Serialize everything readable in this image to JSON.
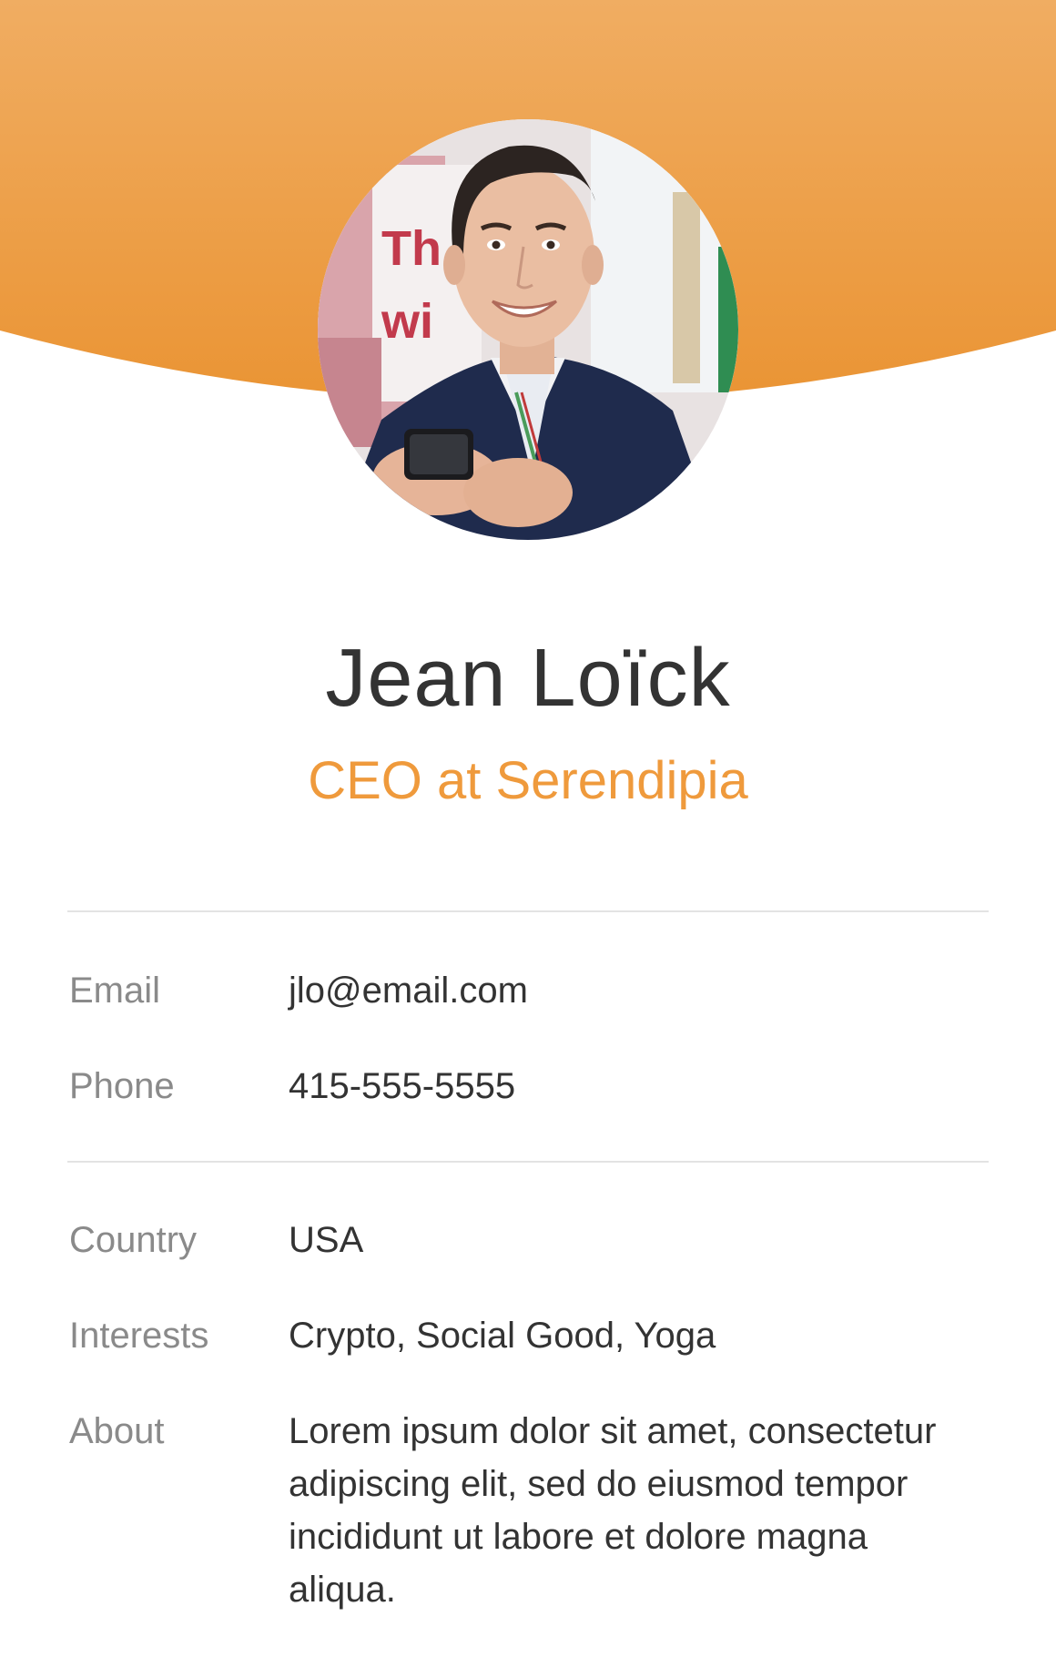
{
  "profile": {
    "name": "Jean Loïck",
    "title": "CEO at Serendipia"
  },
  "contact": {
    "email_label": "Email",
    "email_value": "jlo@email.com",
    "phone_label": "Phone",
    "phone_value": "415-555-5555"
  },
  "details": {
    "country_label": "Country",
    "country_value": "USA",
    "interests_label": "Interests",
    "interests_value": "Crypto, Social Good, Yoga",
    "about_label": "About",
    "about_value": "Lorem ipsum dolor sit amet, consectetur adipiscing elit, sed do eiusmod tempor incididunt ut labore et dolore magna aliqua."
  },
  "colors": {
    "accent": "#ef9a3c",
    "header_top": "#f0ad62",
    "header_bottom": "#ea9434",
    "name_text": "#333333",
    "label_text": "#8a8a8a",
    "divider": "#e3e3e3"
  },
  "icons": {
    "avatar": "profile-photo"
  }
}
